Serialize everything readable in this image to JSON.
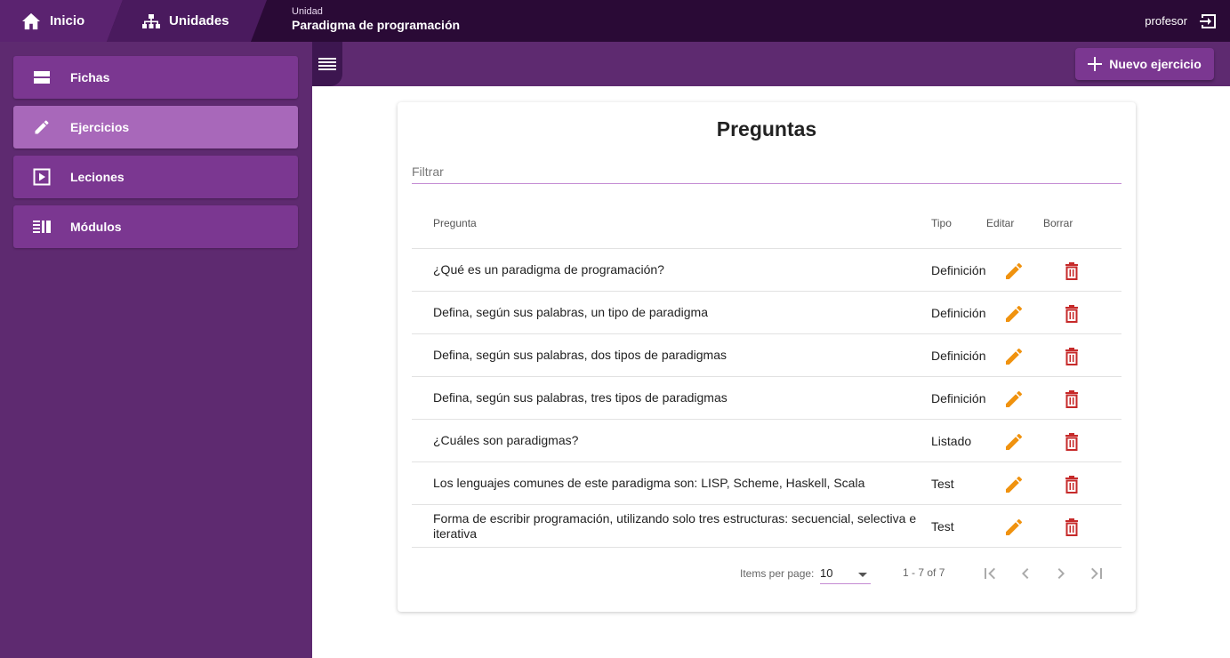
{
  "topbar": {
    "home_label": "Inicio",
    "units_label": "Unidades",
    "unit_caption": "Unidad",
    "unit_name": "Paradigma de programación",
    "user_name": "profesor"
  },
  "sidebar": {
    "items": [
      {
        "label": "Fichas",
        "icon": "cards-icon",
        "active": false
      },
      {
        "label": "Ejercicios",
        "icon": "pencil-icon",
        "active": true
      },
      {
        "label": "Leciones",
        "icon": "play-box-icon",
        "active": false
      },
      {
        "label": "Módulos",
        "icon": "modules-icon",
        "active": false
      }
    ]
  },
  "toolbar": {
    "new_button_label": "Nuevo ejercicio"
  },
  "main": {
    "title": "Preguntas",
    "filter_placeholder": "Filtrar",
    "columns": {
      "question": "Pregunta",
      "type": "Tipo",
      "edit": "Editar",
      "delete": "Borrar"
    },
    "rows": [
      {
        "question": "¿Qué es un paradigma de programación?",
        "type": "Definición"
      },
      {
        "question": "Defina, según sus palabras, un tipo de paradigma",
        "type": "Definición"
      },
      {
        "question": "Defina, según sus palabras, dos tipos de paradigmas",
        "type": "Definición"
      },
      {
        "question": "Defina, según sus palabras, tres tipos de paradigmas",
        "type": "Definición"
      },
      {
        "question": "¿Cuáles son paradigmas?",
        "type": "Listado"
      },
      {
        "question": "Los lenguajes comunes de este paradigma son: LISP, Scheme, Haskell, Scala",
        "type": "Test"
      },
      {
        "question": "Forma de escribir programación, utilizando solo tres estructuras: secuencial, selectiva e iterativa",
        "type": "Test"
      }
    ],
    "paginator": {
      "items_per_page_label": "Items per page:",
      "page_size": "10",
      "range": "1 - 7 of 7"
    }
  },
  "colors": {
    "topbar": "#2a0a36",
    "sidebar": "#5e2a70",
    "sidebar_item": "#7b3791",
    "sidebar_item_active": "#a868ba",
    "edit_icon": "#f0920e",
    "delete_icon": "#c62a2a"
  }
}
